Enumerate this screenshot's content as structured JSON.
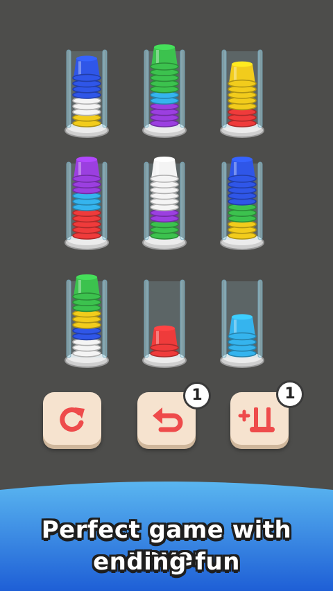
{
  "colors": {
    "background": "#4d4d4b",
    "blue": "#2f56e8",
    "green": "#3cc24e",
    "cyan": "#35b4ee",
    "purple": "#9b3fe0",
    "white": "#f4f4f4",
    "yellow": "#f2cc1c",
    "red": "#ef3b3b",
    "button": "#f6e3cf",
    "icon": "#ee4b4b"
  },
  "tubes": [
    {
      "cups": [
        "yellow",
        "yellow",
        "white",
        "white",
        "white",
        "blue",
        "blue",
        "blue",
        "blue"
      ]
    },
    {
      "cups": [
        "purple",
        "purple",
        "purple",
        "purple",
        "cyan",
        "cyan",
        "green",
        "green",
        "green",
        "green",
        "green"
      ]
    },
    {
      "cups": [
        "red",
        "red",
        "red",
        "yellow",
        "yellow",
        "yellow",
        "yellow",
        "yellow"
      ]
    },
    {
      "cups": [
        "red",
        "red",
        "red",
        "red",
        "red",
        "cyan",
        "cyan",
        "cyan",
        "purple",
        "purple",
        "purple"
      ]
    },
    {
      "cups": [
        "green",
        "green",
        "green",
        "purple",
        "purple",
        "white",
        "white",
        "white",
        "white",
        "white",
        "white"
      ]
    },
    {
      "cups": [
        "yellow",
        "yellow",
        "yellow",
        "green",
        "green",
        "green",
        "blue",
        "blue",
        "blue",
        "blue",
        "blue"
      ]
    },
    {
      "cups": [
        "white",
        "white",
        "white",
        "blue",
        "blue",
        "yellow",
        "yellow",
        "yellow",
        "green",
        "green",
        "green"
      ]
    },
    {
      "cups": [
        "red",
        "red"
      ]
    },
    {
      "cups": [
        "cyan",
        "cyan",
        "cyan",
        "cyan"
      ]
    }
  ],
  "controls": {
    "restart_icon": "restart-icon",
    "undo_icon": "undo-icon",
    "undo_count": "1",
    "add_tube_icon": "add-tube-icon",
    "add_tube_count": "1"
  },
  "banner": {
    "line1": "Perfect game with never",
    "line2": "ending fun"
  }
}
